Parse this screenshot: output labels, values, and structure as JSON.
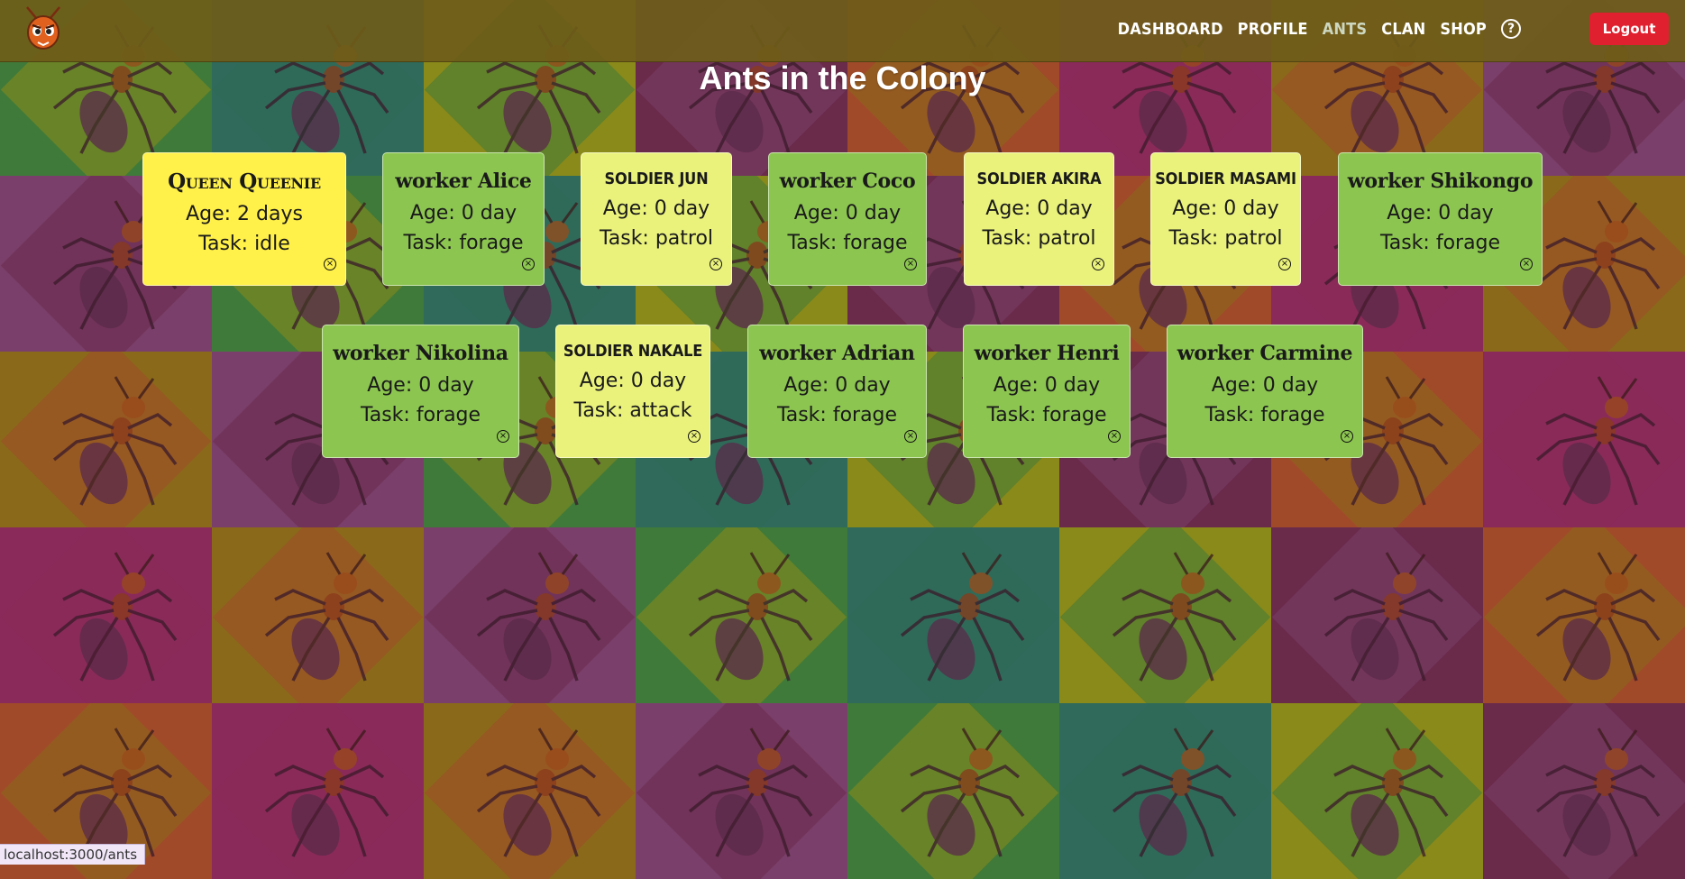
{
  "app": {
    "logo_icon": "ant-logo-icon"
  },
  "nav": {
    "items": [
      {
        "label": "DASHBOARD",
        "active": false
      },
      {
        "label": "PROFILE",
        "active": false
      },
      {
        "label": "ANTS",
        "active": true
      },
      {
        "label": "CLAN",
        "active": false
      },
      {
        "label": "SHOP",
        "active": false
      }
    ],
    "help_label": "?",
    "logout_label": "Logout"
  },
  "page": {
    "title": "Ants in the Colony"
  },
  "ants": [
    {
      "name": "Queen Queenie",
      "type": "queen",
      "age": "Age: 2 days",
      "task": "Task: idle"
    },
    {
      "name": "worker Alice",
      "type": "worker",
      "age": "Age: 0 day",
      "task": "Task: forage"
    },
    {
      "name": "SOLDIER JUN",
      "type": "soldier",
      "age": "Age: 0 day",
      "task": "Task: patrol"
    },
    {
      "name": "worker Coco",
      "type": "worker",
      "age": "Age: 0 day",
      "task": "Task: forage"
    },
    {
      "name": "SOLDIER AKIRA",
      "type": "soldier",
      "age": "Age: 0 day",
      "task": "Task: patrol"
    },
    {
      "name": "SOLDIER MASAMI",
      "type": "soldier",
      "age": "Age: 0 day",
      "task": "Task: patrol"
    },
    {
      "name": "worker Shikongo",
      "type": "worker",
      "age": "Age: 0 day",
      "task": "Task: forage"
    },
    {
      "name": "worker Nikolina",
      "type": "worker",
      "age": "Age: 0 day",
      "task": "Task: forage"
    },
    {
      "name": "SOLDIER NAKALE",
      "type": "soldier",
      "age": "Age: 0 day",
      "task": "Task: attack"
    },
    {
      "name": "worker Adrian",
      "type": "worker",
      "age": "Age: 0 day",
      "task": "Task: forage"
    },
    {
      "name": "worker Henri",
      "type": "worker",
      "age": "Age: 0 day",
      "task": "Task: forage"
    },
    {
      "name": "worker Carmine",
      "type": "worker",
      "age": "Age: 0 day",
      "task": "Task: forage"
    }
  ],
  "close_glyph": "×",
  "status_bar": {
    "url": "localhost:3000/ants"
  },
  "colors": {
    "worker": "#8cc550",
    "soldier": "#eaf27c",
    "queen": "#fff04a",
    "logout": "#e0202e"
  }
}
